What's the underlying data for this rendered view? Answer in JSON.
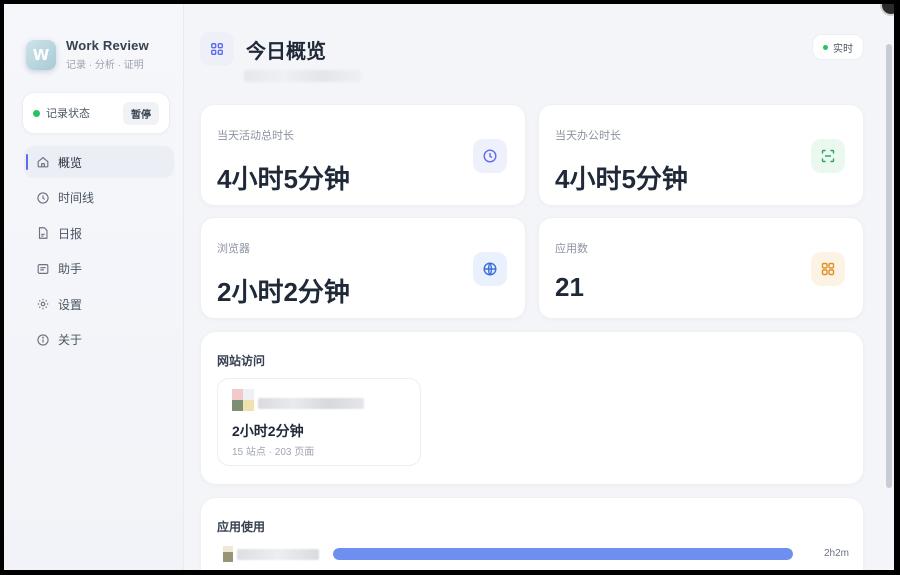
{
  "app": {
    "name": "Work Review",
    "tagline": "记录 · 分析 · 证明"
  },
  "status": {
    "label": "记录状态",
    "pause_label": "暂停"
  },
  "nav": {
    "items": [
      {
        "label": "概览",
        "icon": "home-icon"
      },
      {
        "label": "时间线",
        "icon": "clock-icon"
      },
      {
        "label": "日报",
        "icon": "document-icon"
      },
      {
        "label": "助手",
        "icon": "chat-icon"
      },
      {
        "label": "设置",
        "icon": "gear-icon"
      },
      {
        "label": "关于",
        "icon": "info-icon"
      }
    ]
  },
  "header": {
    "title": "今日概览",
    "live_label": "实时"
  },
  "stats": [
    {
      "label": "当天活动总时长",
      "value": "4小时5分钟",
      "icon": "clock-icon"
    },
    {
      "label": "当天办公时长",
      "value": "4小时5分钟",
      "icon": "scan-icon"
    },
    {
      "label": "浏览器",
      "value": "2小时2分钟",
      "icon": "globe-icon"
    },
    {
      "label": "应用数",
      "value": "21",
      "icon": "grid-icon"
    }
  ],
  "websites": {
    "title": "网站访问",
    "card": {
      "time": "2小时2分钟",
      "meta": "15 站点 · 203 页面"
    }
  },
  "apps": {
    "title": "应用使用",
    "rows": [
      {
        "time": "2h2m",
        "fill_fraction": 1.0
      }
    ]
  },
  "colors": {
    "accent": "#5b6cf0",
    "active_dot": "#22c55e",
    "bar": "#6f8ff0"
  }
}
